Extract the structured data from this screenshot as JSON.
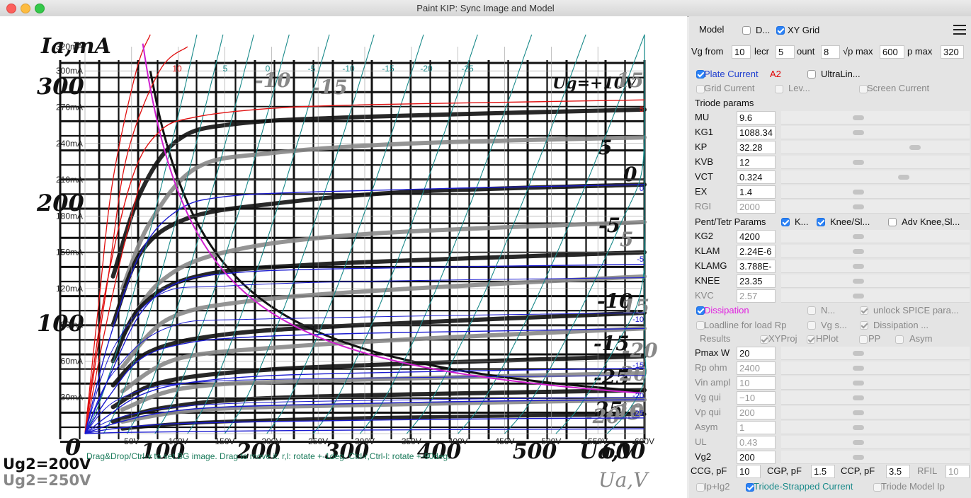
{
  "window": {
    "title": "Paint KIP: Sync Image and Model"
  },
  "background_image": {
    "ylabel": "Ia,mA",
    "xlabel": "Ua,V",
    "xlabel2": "Ua,V",
    "y_marks": [
      "300",
      "200",
      "100",
      "0"
    ],
    "x_marks": [
      "100",
      "200",
      "300",
      "400",
      "500",
      "600"
    ],
    "ug2_lines": [
      "Ug2=200V",
      "Ug2=250V"
    ],
    "curve_marks": [
      "Ug=+10V",
      "5",
      "0",
      "-5",
      "5",
      "-10",
      "15",
      "-15",
      "-20",
      "-25",
      "20",
      "25",
      "10",
      "15",
      "-10",
      "-15",
      "-20",
      "-25"
    ]
  },
  "hint": "Drag&Drop/Ctrl-v to set BG image. Drag to move it. r,l: rotate +-1deg. Ctrl-r,Ctrl-l: rotate +-90deg.",
  "chart_data": {
    "type": "line",
    "xlabel": "Ua,V",
    "ylabel": "Ia,mA",
    "xlim": [
      0,
      600
    ],
    "ylim": [
      0,
      320
    ],
    "x_ticks": [
      "50V",
      "100V",
      "150V",
      "200V",
      "250V",
      "300V",
      "350V",
      "400V",
      "450V",
      "500V",
      "550V",
      "600V"
    ],
    "y_ticks": [
      "30mA",
      "60mA",
      "90mA",
      "120mA",
      "150mA",
      "180mA",
      "210mA",
      "240mA",
      "270mA",
      "300mA",
      "320mA"
    ],
    "dissipation_w": 20,
    "series": [
      {
        "name": "10",
        "grid_v": 10,
        "values": [
          [
            0,
            0
          ],
          [
            20,
            110
          ],
          [
            50,
            210
          ],
          [
            80,
            250
          ],
          [
            120,
            262
          ],
          [
            200,
            269
          ],
          [
            300,
            272
          ],
          [
            450,
            274
          ],
          [
            600,
            276
          ]
        ]
      },
      {
        "name": "5",
        "grid_v": 5,
        "values": [
          [
            0,
            0
          ],
          [
            25,
            75
          ],
          [
            60,
            150
          ],
          [
            100,
            185
          ],
          [
            150,
            196
          ],
          [
            250,
            200
          ],
          [
            400,
            203
          ],
          [
            600,
            206
          ]
        ]
      },
      {
        "name": "0",
        "grid_v": 0,
        "values": [
          [
            0,
            0
          ],
          [
            25,
            45
          ],
          [
            60,
            100
          ],
          [
            100,
            125
          ],
          [
            160,
            133
          ],
          [
            250,
            136
          ],
          [
            400,
            138
          ],
          [
            600,
            140
          ]
        ]
      },
      {
        "name": "-5",
        "grid_v": -5,
        "values": [
          [
            0,
            0
          ],
          [
            25,
            30
          ],
          [
            60,
            62
          ],
          [
            110,
            75
          ],
          [
            180,
            80
          ],
          [
            300,
            83
          ],
          [
            450,
            85
          ],
          [
            600,
            87
          ]
        ]
      },
      {
        "name": "-10",
        "grid_v": -10,
        "values": [
          [
            0,
            0
          ],
          [
            25,
            15
          ],
          [
            60,
            32
          ],
          [
            110,
            42
          ],
          [
            200,
            48
          ],
          [
            350,
            51
          ],
          [
            500,
            53
          ],
          [
            600,
            54
          ]
        ]
      },
      {
        "name": "-15",
        "grid_v": -15,
        "values": [
          [
            0,
            0
          ],
          [
            30,
            8
          ],
          [
            80,
            17
          ],
          [
            150,
            22
          ],
          [
            300,
            25
          ],
          [
            450,
            27
          ],
          [
            600,
            28
          ]
        ]
      },
      {
        "name": "-20",
        "grid_v": -20,
        "values": [
          [
            0,
            0
          ],
          [
            30,
            4
          ],
          [
            90,
            8
          ],
          [
            200,
            10
          ],
          [
            400,
            12
          ],
          [
            600,
            13
          ]
        ]
      },
      {
        "name": "-25",
        "grid_v": -25,
        "values": [
          [
            0,
            0
          ],
          [
            40,
            1
          ],
          [
            150,
            2
          ],
          [
            300,
            3
          ],
          [
            600,
            4
          ]
        ]
      }
    ],
    "load_line_labels": [
      "10",
      "5",
      "0",
      "-5",
      "-10",
      "-15",
      "-20",
      "-25"
    ],
    "right_labels": [
      "5",
      "0",
      "-5",
      "-10",
      "-15",
      "-20",
      "-25"
    ]
  },
  "panel": {
    "model_label": "Model",
    "d_label": "D...",
    "xy_grid_label": "XY Grid",
    "vg_from_label": "Vg from",
    "vg_from": "10",
    "decr_label": "lecr",
    "decr": "5",
    "count_label": "ount",
    "count": "8",
    "vp_max_label": "√p max",
    "vp_max": "600",
    "ip_max_label": "p max",
    "ip_max": "320",
    "plate_current_label": "Plate Current",
    "a2_label": "A2",
    "ultralin_label": "UltraLin...",
    "grid_current_label": "Grid Current",
    "lev_label": "Lev...",
    "screen_current_label": "Screen Current",
    "triode_params_label": "Triode params",
    "triode_params": [
      {
        "name": "MU",
        "value": "9.6",
        "knob": 0.41
      },
      {
        "name": "KG1",
        "value": "1088.34",
        "knob": 0.41
      },
      {
        "name": "KP",
        "value": "32.28",
        "knob": 0.71
      },
      {
        "name": "KVB",
        "value": "12",
        "knob": 0.41
      },
      {
        "name": "VCT",
        "value": "0.324",
        "knob": 0.65
      },
      {
        "name": "EX",
        "value": "1.4",
        "knob": 0.41
      },
      {
        "name": "RGI",
        "value": "2000",
        "knob": 0.41
      }
    ],
    "pent_label": "Pent/Tetr Params",
    "k_label": "K...",
    "knee_sl_label": "Knee/Sl...",
    "adv_knee_label": "Adv Knee,Sl...",
    "pent_params": [
      {
        "name": "KG2",
        "value": "4200",
        "knob": 0.41
      },
      {
        "name": "KLAM",
        "value": "2.24E-6",
        "knob": 0.41
      },
      {
        "name": "KLAMG",
        "value": "3.788E-",
        "knob": 0.41
      },
      {
        "name": "KNEE",
        "value": "23.35",
        "knob": 0.41
      },
      {
        "name": "KVC",
        "value": "2.57",
        "knob": 0.41
      }
    ],
    "dissipation_label": "Dissipation",
    "n_label": "N...",
    "unlock_spice_label": "unlock SPICE para...",
    "loadline_label": "Loadline for load Rp",
    "vg_s_label": "Vg s...",
    "dissipation2_label": "Dissipation ...",
    "results_label": "Results",
    "xyproj_label": "XYProj",
    "hplot_label": "HPlot",
    "pp_label": "PP",
    "asym_label": "Asym",
    "load_params": [
      {
        "name": "Pmax W",
        "value": "20",
        "knob": 0.41
      },
      {
        "name": "Rp ohm",
        "value": "2400",
        "knob": 0.41
      },
      {
        "name": "Vin ampl",
        "value": "10",
        "knob": 0.41
      },
      {
        "name": "Vg qui",
        "value": "−10",
        "knob": 0.41
      },
      {
        "name": "Vp qui",
        "value": "200",
        "knob": 0.41
      },
      {
        "name": "Asym",
        "value": "1",
        "knob": 0.41
      },
      {
        "name": "UL",
        "value": "0.43",
        "knob": 0.41
      },
      {
        "name": "Vg2",
        "value": "200",
        "knob": 0.41
      }
    ],
    "ccg_label": "CCG, pF",
    "ccg": "10",
    "cgp_label": "CGP, pF",
    "cgp": "1.5",
    "ccp_label": "CCP, pF",
    "ccp": "3.5",
    "rfil_label": "RFIL",
    "rfil": "10",
    "ip_ig2_label": "Ip+Ig2",
    "triode_strapped_label": "Triode-Strapped Current",
    "triode_model_label": "Triode Model Ip"
  },
  "colors": {
    "plate": "#1f3fcf",
    "a2": "#e00000",
    "dissipation": "#e020e0",
    "triode_strapped": "#1a8a8a",
    "hint": "#1a7a5a",
    "red_curve": "#e01010",
    "blue_curve": "#1a1acf",
    "teal": "#1a8a8a",
    "magenta": "#d020d0"
  }
}
